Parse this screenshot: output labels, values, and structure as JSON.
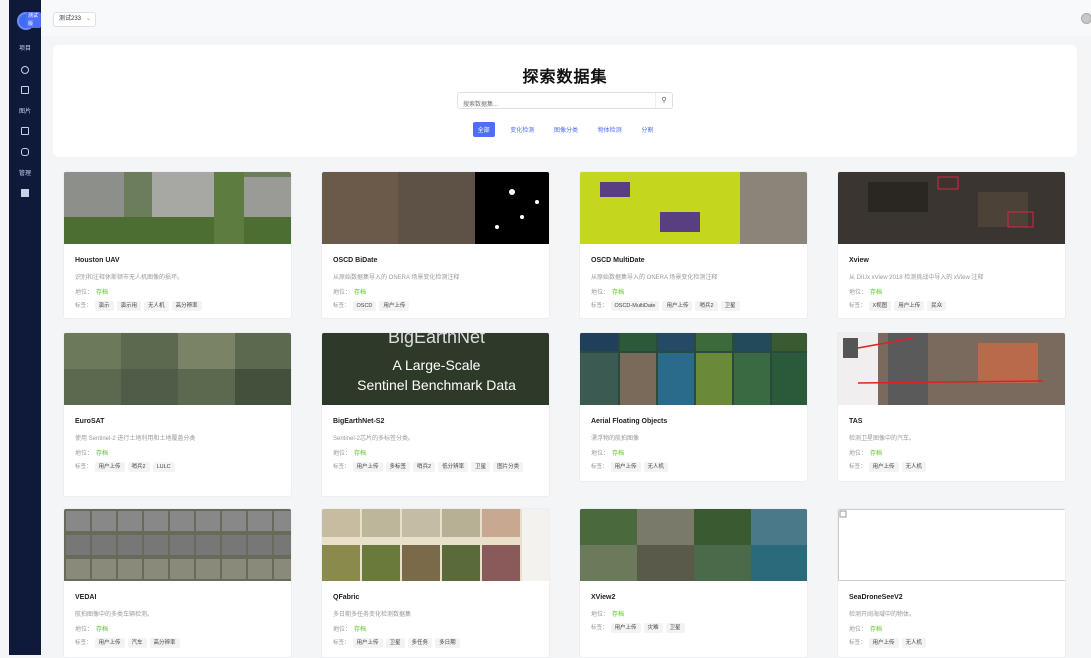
{
  "sidebar": {
    "badge": "测试版",
    "items": [
      {
        "label": "项目",
        "icon": "folder-icon"
      },
      {
        "label": "",
        "icon": "compass-icon"
      },
      {
        "label": "",
        "icon": "folder-icon"
      },
      {
        "label": "图片",
        "icon": "image-icon"
      },
      {
        "label": "",
        "icon": "picture-icon"
      },
      {
        "label": "",
        "icon": "lock-icon"
      },
      {
        "label": "管理",
        "icon": "settings-icon"
      },
      {
        "label": "",
        "icon": "grid-icon"
      }
    ]
  },
  "topbar": {
    "project": "测试233"
  },
  "hero": {
    "title": "探索数据集",
    "search_placeholder": "搜索数据集...",
    "filters": [
      "全部",
      "变化检测",
      "图像分类",
      "物体检测",
      "分割"
    ]
  },
  "labels": {
    "status": "地位：",
    "tags": "标签："
  },
  "datasets": [
    {
      "title": "Houston UAV",
      "desc": "识别和注释休斯顿市无人机图像的损坏。",
      "status": "存档",
      "tags": [
        "演示",
        "演示用",
        "无人机",
        "高分辨率"
      ]
    },
    {
      "title": "OSCD BiDate",
      "desc": "从原始数据集导入的 ONERA 场景变化检测注释",
      "status": "存档",
      "tags": [
        "OSCD",
        "用户上传"
      ]
    },
    {
      "title": "OSCD MultiDate",
      "desc": "从原始数据集导入的 ONERA 场景变化检测注释",
      "status": "存档",
      "tags": [
        "OSCD-MultiDate",
        "用户上传",
        "哨兵2",
        "卫星"
      ]
    },
    {
      "title": "Xview",
      "desc": "从 DIUx xView 2018 检测挑战中导入的 xView 注释",
      "status": "存档",
      "tags": [
        "X视图",
        "用户上传",
        "民众"
      ]
    },
    {
      "title": "EuroSAT",
      "desc": "使用 Sentinel-2 进行土地利用和土地覆盖分类",
      "status": "存档",
      "tags": [
        "用户上传",
        "哨兵2",
        "LULC"
      ]
    },
    {
      "title": "BigEarthNet-S2",
      "desc": "Sentinel-2芯片的多标签分类。",
      "status": "存档",
      "tags": [
        "用户上传",
        "多标签",
        "哨兵2",
        "低分辨率",
        "卫星",
        "图片分类"
      ]
    },
    {
      "title": "Aerial Floating Objects",
      "desc": "漂浮物的航拍图像",
      "status": "存档",
      "tags": [
        "用户上传",
        "无人机"
      ]
    },
    {
      "title": "TAS",
      "desc": "检测卫星图像中的汽车。",
      "status": "存档",
      "tags": [
        "用户上传",
        "无人机"
      ]
    },
    {
      "title": "VEDAI",
      "desc": "航拍图像中的多类车辆检测。",
      "status": "存档",
      "tags": [
        "用户上传",
        "汽车",
        "高分辨率"
      ]
    },
    {
      "title": "QFabric",
      "desc": "多日期多任务变化检测数据集",
      "status": "存档",
      "tags": [
        "用户上传",
        "卫星",
        "多任务",
        "多日期"
      ]
    },
    {
      "title": "XView2",
      "desc": "",
      "status": "存档",
      "tags": [
        "用户上传",
        "灾难",
        "卫星"
      ]
    },
    {
      "title": "SeaDroneSeeV2",
      "desc": "检测开阔海域中的物体。",
      "status": "存档",
      "tags": [
        "用户上传",
        "无人机"
      ]
    }
  ],
  "thumb_text": {
    "big_title": "BigEarthNet",
    "line1": "A Large-Scale",
    "line2": "Sentinel Benchmark Data"
  }
}
